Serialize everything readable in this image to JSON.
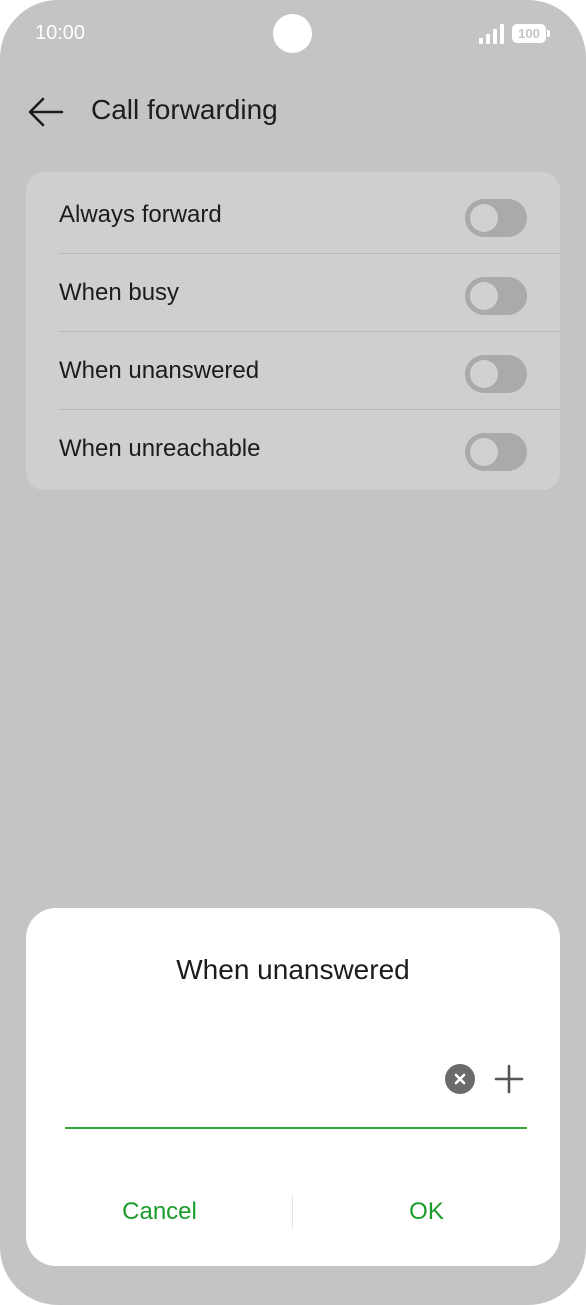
{
  "status_bar": {
    "time": "10:00",
    "battery": "100",
    "icons": [
      "signal-icon",
      "battery-icon"
    ]
  },
  "app_bar": {
    "title": "Call forwarding",
    "back_icon": "arrow-left-icon"
  },
  "settings": {
    "items": [
      {
        "label": "Always forward",
        "enabled": false
      },
      {
        "label": "When busy",
        "enabled": false
      },
      {
        "label": "When unanswered",
        "enabled": false
      },
      {
        "label": "When unreachable",
        "enabled": false
      }
    ]
  },
  "dialog": {
    "title": "When unanswered",
    "input_value": "",
    "clear_icon": "clear-x-icon",
    "add_icon": "plus-icon",
    "cancel_label": "Cancel",
    "ok_label": "OK"
  },
  "colors": {
    "background": "#c3c4c6",
    "card": "#cfcfd0",
    "accent": "#1a9c2a",
    "underline": "#2fa53a",
    "toggle_track": "#a9aaab"
  }
}
